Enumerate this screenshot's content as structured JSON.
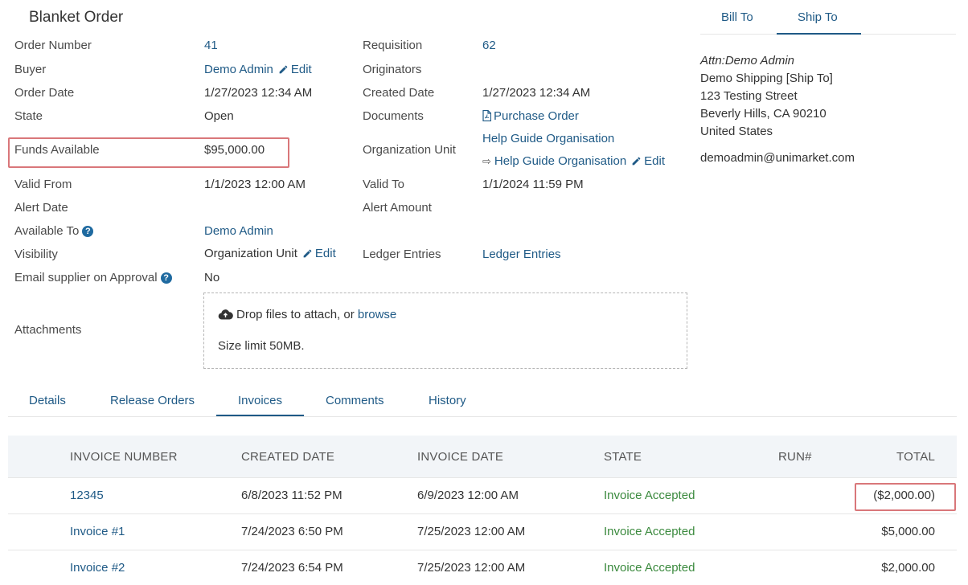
{
  "title": "Blanket Order",
  "fields_left": {
    "order_number_label": "Order Number",
    "order_number": "41",
    "buyer_label": "Buyer",
    "buyer": "Demo Admin",
    "edit": "Edit",
    "order_date_label": "Order Date",
    "order_date": "1/27/2023 12:34 AM",
    "state_label": "State",
    "state": "Open",
    "funds_label": "Funds Available",
    "funds": "$95,000.00",
    "valid_from_label": "Valid From",
    "valid_from": "1/1/2023 12:00 AM",
    "alert_date_label": "Alert Date",
    "available_to_label": "Available To",
    "available_to": "Demo Admin",
    "visibility_label": "Visibility",
    "visibility": "Organization Unit",
    "email_label": "Email supplier on Approval",
    "email": "No",
    "attachments_label": "Attachments"
  },
  "fields_mid": {
    "requisition_label": "Requisition",
    "requisition": "62",
    "originators_label": "Originators",
    "created_label": "Created Date",
    "created": "1/27/2023 12:34 AM",
    "documents_label": "Documents",
    "documents": "Purchase Order",
    "org_unit_label": "Organization Unit",
    "org_unit": "Help Guide Organisation",
    "org_unit_sub": "Help Guide Organisation",
    "valid_to_label": "Valid To",
    "valid_to": "1/1/2024 11:59 PM",
    "alert_amount_label": "Alert Amount",
    "ledger_label": "Ledger Entries",
    "ledger": "Ledger Entries"
  },
  "attach": {
    "drop_text": "Drop files to attach, or",
    "browse": "browse",
    "limit": "Size limit 50MB."
  },
  "address_tabs": [
    "Bill To",
    "Ship To"
  ],
  "address": {
    "attn": "Attn:Demo Admin",
    "line1": "Demo Shipping [Ship To]",
    "line2": "123 Testing Street",
    "line3": "Beverly Hills, CA 90210",
    "line4": "United States",
    "email": "demoadmin@unimarket.com"
  },
  "tabs": [
    "Details",
    "Release Orders",
    "Invoices",
    "Comments",
    "History"
  ],
  "table": {
    "headers": [
      "INVOICE NUMBER",
      "CREATED DATE",
      "INVOICE DATE",
      "STATE",
      "RUN#",
      "TOTAL"
    ],
    "rows": [
      [
        "12345",
        "6/8/2023 11:52 PM",
        "6/9/2023 12:00 AM",
        "Invoice Accepted",
        "",
        "($2,000.00)"
      ],
      [
        "Invoice #1",
        "7/24/2023 6:50 PM",
        "7/25/2023 12:00 AM",
        "Invoice Accepted",
        "",
        "$5,000.00"
      ],
      [
        "Invoice #2",
        "7/24/2023 6:54 PM",
        "7/25/2023 12:00 AM",
        "Invoice Accepted",
        "",
        "$2,000.00"
      ]
    ]
  },
  "colors": {
    "link": "#1f5a86",
    "accepted": "#3b8a3e",
    "highlight": "#d9777a"
  }
}
